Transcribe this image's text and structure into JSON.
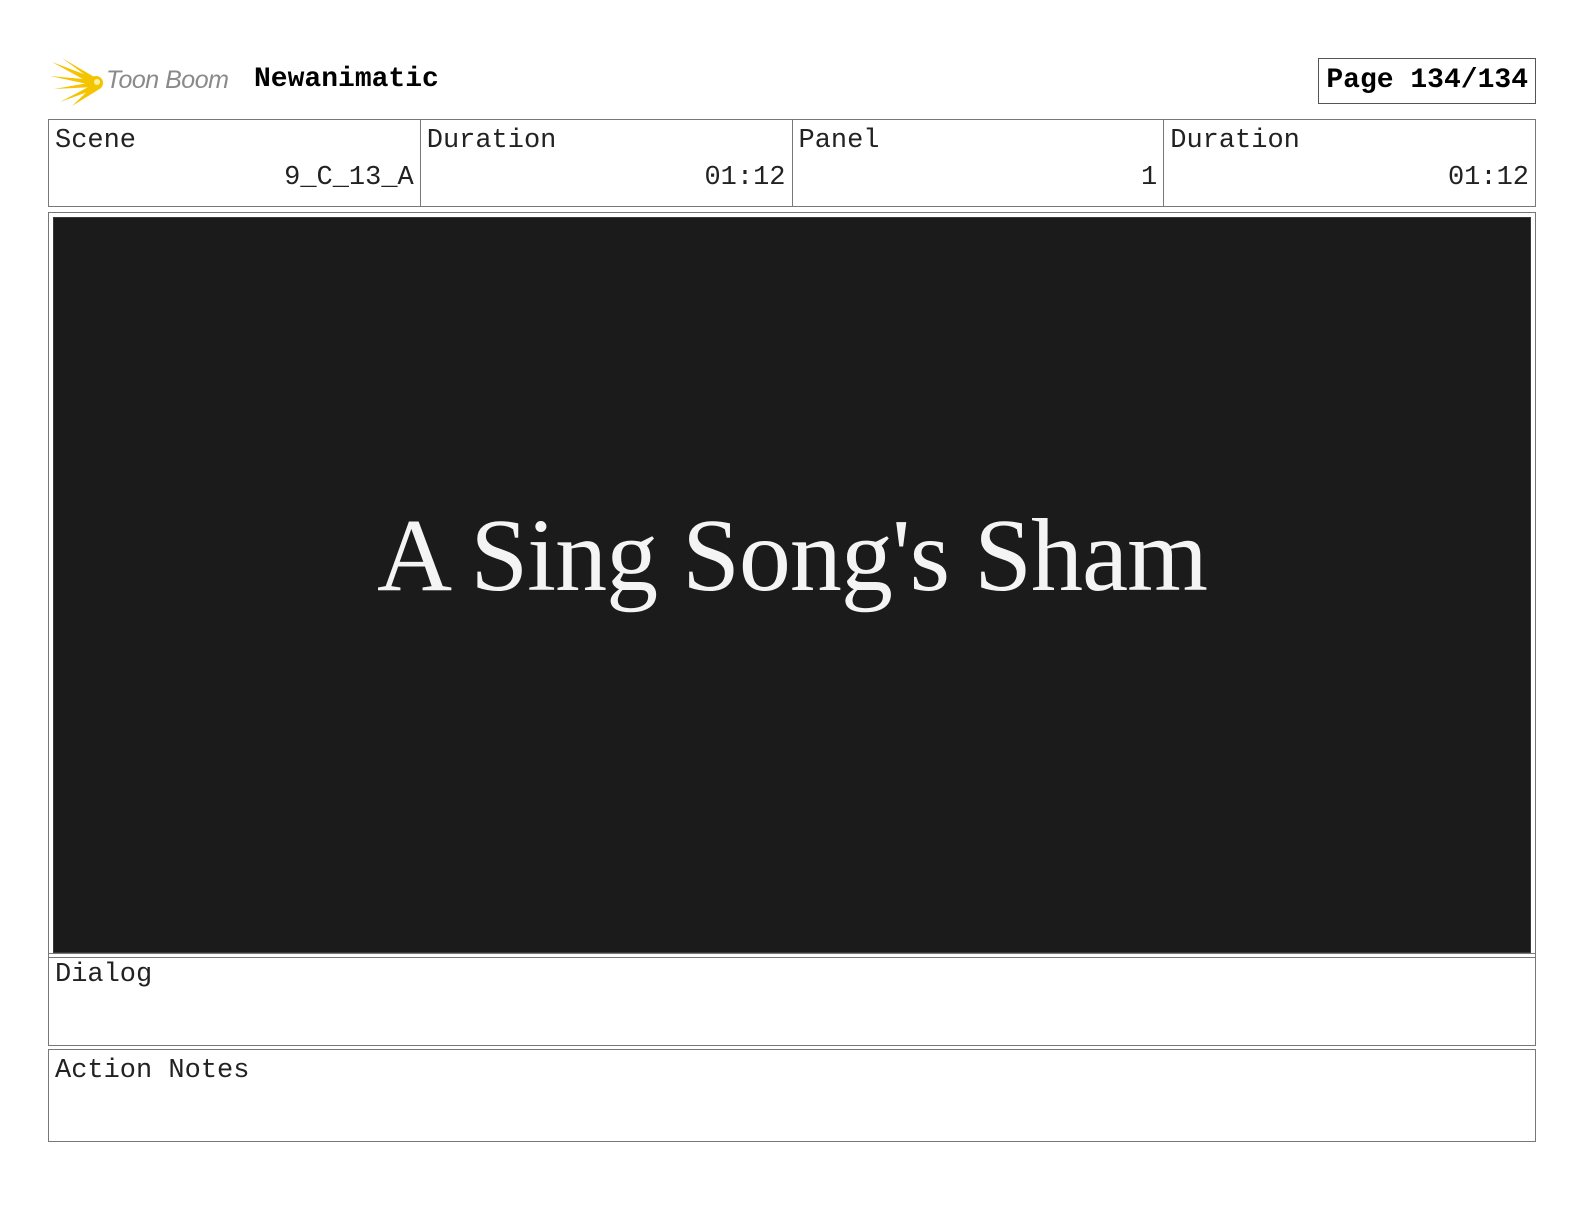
{
  "header": {
    "brand_text": "Toon Boom",
    "project_title": "Newanimatic",
    "page_label": "Page 134/134"
  },
  "info": [
    {
      "label": "Scene",
      "value": "9_C_13_A"
    },
    {
      "label": "Duration",
      "value": "01:12"
    },
    {
      "label": "Panel",
      "value": "1"
    },
    {
      "label": "Duration",
      "value": "01:12"
    }
  ],
  "panel": {
    "title_text": "A Sing Song's Sham"
  },
  "dialog": {
    "label": "Dialog"
  },
  "action_notes": {
    "label": "Action Notes"
  },
  "colors": {
    "panel_background": "#1b1b1b",
    "logo_yellow": "#f5c400",
    "logo_text_gray": "#8a8a8a"
  },
  "icons": {
    "logo": "toon-boom-logo-icon"
  }
}
